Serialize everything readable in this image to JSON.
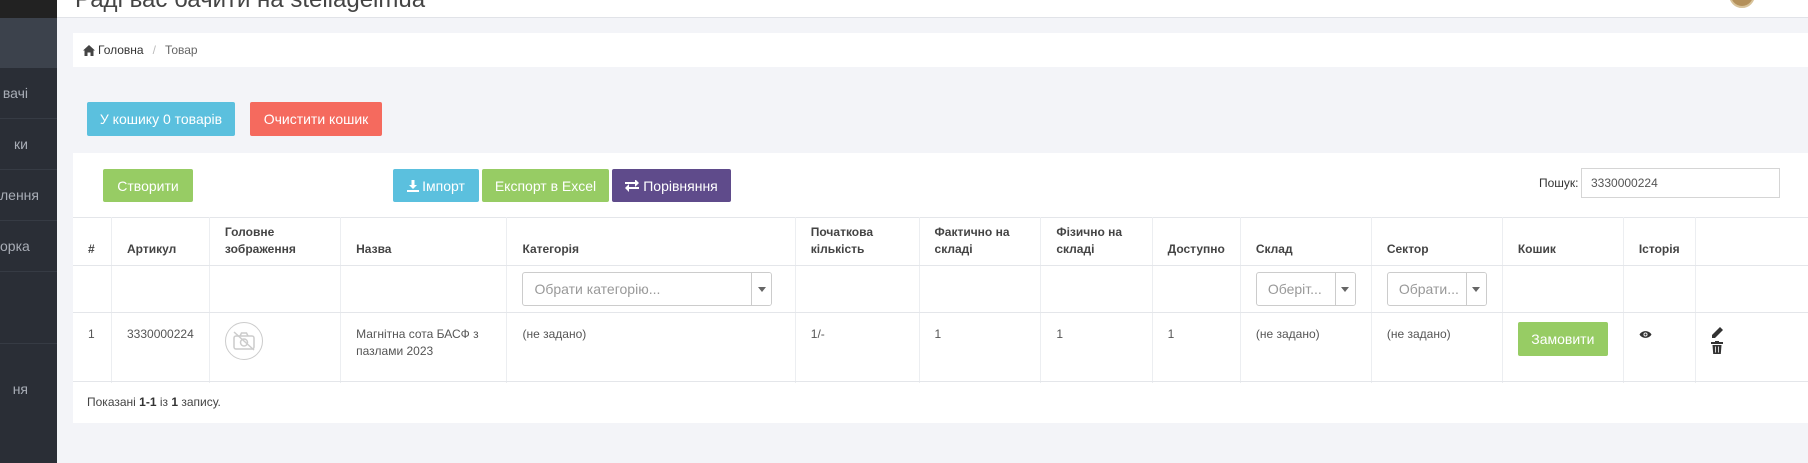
{
  "sidebar": {
    "items": [
      {
        "label": "вачі"
      },
      {
        "label": "ки"
      },
      {
        "label": "лення"
      },
      {
        "label": "орка"
      },
      {
        "label": "ня"
      }
    ]
  },
  "header": {
    "title": "Раді вас бачити на stellagelmua"
  },
  "breadcrumb": {
    "home": "Головна",
    "current": "Товар"
  },
  "cart": {
    "cart_button": "У кошику 0 товарів",
    "clear_button": "Очистити кошик"
  },
  "toolbar": {
    "create": "Створити",
    "import": "Імпорт",
    "export": "Експорт в Excel",
    "compare": "Порівняння",
    "search_label": "Пошук:",
    "search_value": "3330000224"
  },
  "table": {
    "columns": [
      "#",
      "Артикул",
      "Головне зображення",
      "Назва",
      "Категорія",
      "Початкова кількість",
      "Фактично на складі",
      "Фізично на складі",
      "Доступно",
      "Склад",
      "Сектор",
      "Кошик",
      "Історія",
      ""
    ],
    "filters": {
      "category_placeholder": "Обрати категорію...",
      "warehouse_placeholder": "Оберіт...",
      "sector_placeholder": "Обрати..."
    },
    "rows": [
      {
        "num": "1",
        "article": "3330000224",
        "name": "Магнітна сота БАСФ з пазлами 2023",
        "category": "(не задано)",
        "initial_qty": "1/-",
        "actual_stock": "1",
        "physical_stock": "1",
        "available": "1",
        "warehouse": "(не задано)",
        "sector": "(не задано)",
        "order_button": "Замовити"
      }
    ]
  },
  "summary": {
    "prefix": "Показані ",
    "range": "1-1",
    "middle": " із ",
    "total": "1",
    "suffix": " запису."
  },
  "colors": {
    "info": "#5bc0de",
    "danger": "#f56a5e",
    "success": "#97cc64",
    "purple": "#5f4b8b",
    "sidebar": "#2a2e36"
  }
}
